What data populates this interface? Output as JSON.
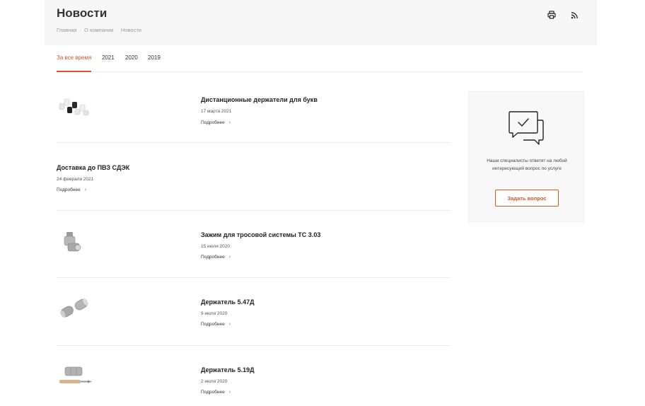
{
  "header": {
    "title": "Новости",
    "breadcrumb": [
      "Главная",
      "О компании",
      "Новости"
    ],
    "breadcrumb_separator": "·",
    "icons": [
      "print-icon",
      "rss-icon"
    ]
  },
  "tabs": [
    {
      "label": "За все время",
      "active": true
    },
    {
      "label": "2021",
      "active": false
    },
    {
      "label": "2020",
      "active": false
    },
    {
      "label": "2019",
      "active": false
    }
  ],
  "news": [
    {
      "title": "Дистанционные держатели для букв",
      "date": "17 марта 2021",
      "more": "Подробнее",
      "has_image": true
    },
    {
      "title": "Доставка до ПВЗ СДЭК",
      "date": "24 февраля 2021",
      "more": "Подробнее",
      "has_image": false
    },
    {
      "title": "Зажим для тросовой системы ТС 3.03",
      "date": "15 июля 2020",
      "more": "Подробнее",
      "has_image": true
    },
    {
      "title": "Держатель 5.47Д",
      "date": "9 июля 2020",
      "more": "Подробнее",
      "has_image": true
    },
    {
      "title": "Держатель 5.19Д",
      "date": "2 июля 2020",
      "more": "Подробнее",
      "has_image": true
    }
  ],
  "sidebar": {
    "text": "Наши специалисты ответят на любой интересующий вопрос по услуге",
    "button": "Задать вопрос",
    "icon": "chat-bubbles-icon"
  },
  "colors": {
    "accent": "#d0582a",
    "header_bg": "#f7f7f7",
    "card_bg": "#f8f8f8"
  }
}
